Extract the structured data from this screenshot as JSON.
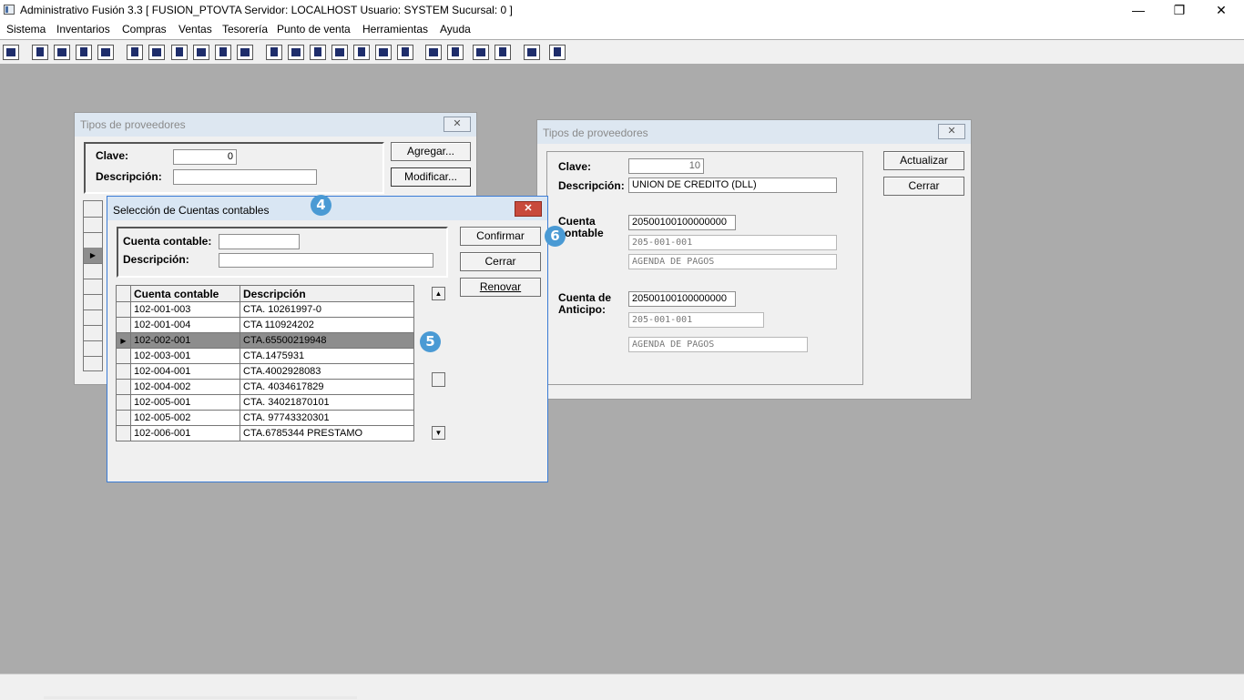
{
  "app": {
    "title": "Administrativo Fusión 3.3 [ FUSION_PTOVTA   Servidor: LOCALHOST   Usuario: SYSTEM     Sucursal: 0 ]",
    "minimize_glyph": "—",
    "restore_glyph": "❐",
    "close_glyph": "✕"
  },
  "menu": [
    "Sistema",
    "Inventarios",
    "Compras",
    "Ventas",
    "Tesorería",
    "Punto de venta",
    "Herramientas",
    "Ayuda"
  ],
  "toolbar": {
    "icons": [
      "calculator-icon",
      "copy-icon",
      "paste-icon",
      "transfer-icon",
      "search-document-icon",
      "person-icon",
      "folder-icon",
      "print-preview-icon",
      "print-icon",
      "document-icon",
      "list-icon",
      "binoculars-icon",
      "window-icon",
      "export-icon",
      "add-icon",
      "dollar-icon",
      "report-icon",
      "table-icon",
      "home-icon",
      "zoom-icon",
      "refresh-icon",
      "undo-icon",
      "back-arrow-icon",
      "help-icon"
    ]
  },
  "bg_window": {
    "title": "Tipos de proveedores",
    "clave_label": "Clave:",
    "clave_value": "0",
    "descripcion_label": "Descripción:",
    "descripcion_value": "",
    "agregar_label": "Agregar...",
    "modificar_label": "Modificar..."
  },
  "edit_window": {
    "title": "Tipos de proveedores",
    "clave_label": "Clave:",
    "clave_value": "10",
    "descripcion_label": "Descripción:",
    "descripcion_value": "UNION DE CREDITO (DLL)",
    "cuenta_contable_label_1": "Cuenta",
    "cuenta_contable_label_2": "ontable",
    "cuenta_contable_value": "20500100100000000",
    "cuenta_contable_formatted": "205-001-001",
    "cuenta_contable_desc": "AGENDA DE PAGOS",
    "cuenta_anticipo_label_1": "Cuenta de",
    "cuenta_anticipo_label_2": "Anticipo:",
    "cuenta_anticipo_value": "20500100100000000",
    "cuenta_anticipo_formatted": "205-001-001",
    "cuenta_anticipo_desc": "AGENDA DE PAGOS",
    "actualizar_label": "Actualizar",
    "cerrar_label": "Cerrar"
  },
  "select_dialog": {
    "title": "Selección de Cuentas contables",
    "cuenta_label": "Cuenta contable:",
    "cuenta_value": "",
    "descripcion_label": "Descripción:",
    "descripcion_value": "",
    "confirmar_label": "Confirmar",
    "cerrar_label": "Cerrar",
    "renovar_label": "Renovar",
    "columns": [
      "Cuenta contable",
      "Descripción"
    ],
    "rows": [
      {
        "cuenta": "102-001-003",
        "desc": "CTA. 10261997-0"
      },
      {
        "cuenta": "102-001-004",
        "desc": "CTA  110924202"
      },
      {
        "cuenta": "102-002-001",
        "desc": "CTA.65500219948"
      },
      {
        "cuenta": "102-003-001",
        "desc": "CTA.1475931"
      },
      {
        "cuenta": "102-004-001",
        "desc": "CTA.4002928083"
      },
      {
        "cuenta": "102-004-002",
        "desc": "CTA.  4034617829"
      },
      {
        "cuenta": "102-005-001",
        "desc": "CTA.  34021870101"
      },
      {
        "cuenta": "102-005-002",
        "desc": "CTA.  97743320301"
      },
      {
        "cuenta": "102-006-001",
        "desc": "CTA.6785344 PRESTAMO"
      }
    ],
    "selected_index": 2,
    "row_indicator": "▶",
    "scroll_up": "▲",
    "scroll_down": "▼"
  },
  "badges": {
    "b4": "4",
    "b5": "5",
    "b6": "6"
  },
  "colors": {
    "badge": "#4a9ad4",
    "selected_row": "#8d8d8d",
    "workspace": "#ababab"
  }
}
